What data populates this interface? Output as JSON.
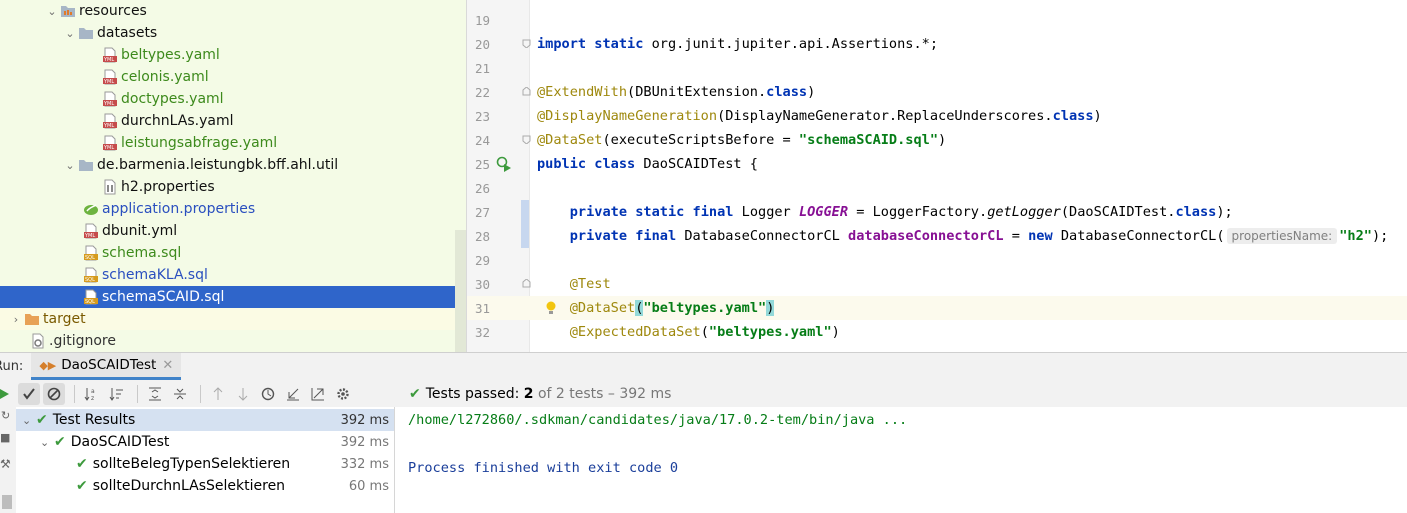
{
  "project_tree": {
    "items": [
      {
        "label": "resources",
        "icon": "resources-folder-icon",
        "color": "c-black"
      },
      {
        "label": "datasets",
        "icon": "folder-icon",
        "color": "c-black"
      },
      {
        "label": "beltypes.yaml",
        "icon": "yaml-file-icon",
        "color": "c-green"
      },
      {
        "label": "celonis.yaml",
        "icon": "yaml-file-icon",
        "color": "c-green"
      },
      {
        "label": "doctypes.yaml",
        "icon": "yaml-file-icon",
        "color": "c-green"
      },
      {
        "label": "durchnLAs.yaml",
        "icon": "yaml-file-icon",
        "color": "c-black"
      },
      {
        "label": "leistungsabfrage.yaml",
        "icon": "yaml-file-icon",
        "color": "c-green"
      },
      {
        "label": "de.barmenia.leistungbk.bff.ahl.util",
        "icon": "folder-icon",
        "color": "c-black"
      },
      {
        "label": "h2.properties",
        "icon": "properties-file-icon",
        "color": "c-black"
      },
      {
        "label": "application.properties",
        "icon": "spring-properties-icon",
        "color": "c-blue"
      },
      {
        "label": "dbunit.yml",
        "icon": "yaml-file-icon",
        "color": "c-black"
      },
      {
        "label": "schema.sql",
        "icon": "sql-file-icon",
        "color": "c-green"
      },
      {
        "label": "schemaKLA.sql",
        "icon": "sql-file-icon",
        "color": "c-blue"
      },
      {
        "label": "schemaSCAID.sql",
        "icon": "sql-file-icon",
        "color": "c-black"
      },
      {
        "label": "target",
        "icon": "excluded-folder-icon",
        "color": "c-brown"
      },
      {
        "label": ".gitignore",
        "icon": "gitignore-file-icon",
        "color": "c-gray"
      }
    ]
  },
  "editor": {
    "line_numbers": [
      "19",
      "20",
      "21",
      "22",
      "23",
      "24",
      "25",
      "26",
      "27",
      "28",
      "29",
      "30",
      "31",
      "32"
    ],
    "line1_import": "import",
    "line1_static": "static",
    "line1_pkg": "org.junit.jupiter.api.Assertions.*;",
    "line3_ann": "@ExtendWith",
    "line3_rest": "(DBUnitExtension.",
    "line3_class": "class",
    "line3_end": ")",
    "line4_ann": "@DisplayNameGeneration",
    "line4_rest": "(DisplayNameGenerator.ReplaceUnderscores.",
    "line4_class": "class",
    "line4_end": ")",
    "line5_ann": "@DataSet",
    "line5_rest": "(executeScriptsBefore = ",
    "line5_str": "\"schemaSCAID.sql\"",
    "line5_end": ")",
    "line6_public": "public",
    "line6_class": "class",
    "line6_rest": " DaoSCAIDTest {",
    "line8_private": "private",
    "line8_static": "static",
    "line8_final": "final",
    "line8_type": " Logger ",
    "line8_field": "LOGGER",
    "line8_eq": " = LoggerFactory.",
    "line8_method": "getLogger",
    "line8_args": "(DaoSCAIDTest.",
    "line8_class": "class",
    "line8_end": ");",
    "line9_private": "private",
    "line9_final": "final",
    "line9_type": " DatabaseConnectorCL ",
    "line9_field": "databaseConnectorCL",
    "line9_eq": " = ",
    "line9_new": "new",
    "line9_ctor": " DatabaseConnectorCL(",
    "line9_hint": "propertiesName:",
    "line9_str": "\"h2\"",
    "line9_end": ");",
    "line11_ann": "@Test",
    "line12_ann": "@DataSet",
    "line12_open": "(",
    "line12_str": "\"beltypes.yaml\"",
    "line12_close": ")",
    "line13_ann": "@ExpectedDataSet",
    "line13_open": "(",
    "line13_str": "\"beltypes.yaml\"",
    "line13_close": ")"
  },
  "run_panel": {
    "run_label": "Run:",
    "tab_label": "DaoSCAIDTest",
    "status_prefix": "Tests passed:",
    "passed_count": "2",
    "status_suffix": "of 2 tests – 392 ms",
    "results": [
      {
        "label": "Test Results",
        "time": "392 ms"
      },
      {
        "label": "DaoSCAIDTest",
        "time": "392 ms"
      },
      {
        "label": "sollteBelegTypenSelektieren",
        "time": "332 ms"
      },
      {
        "label": "sollteDurchnLAsSelektieren",
        "time": "60 ms"
      }
    ],
    "console": [
      "/home/l272860/.sdkman/candidates/java/17.0.2-tem/bin/java ...",
      "Process finished with exit code 0"
    ]
  },
  "colors": {
    "accent": "#2f65ca",
    "test_pass": "#3d9a3d",
    "project_bg": "#f4fbe6"
  }
}
